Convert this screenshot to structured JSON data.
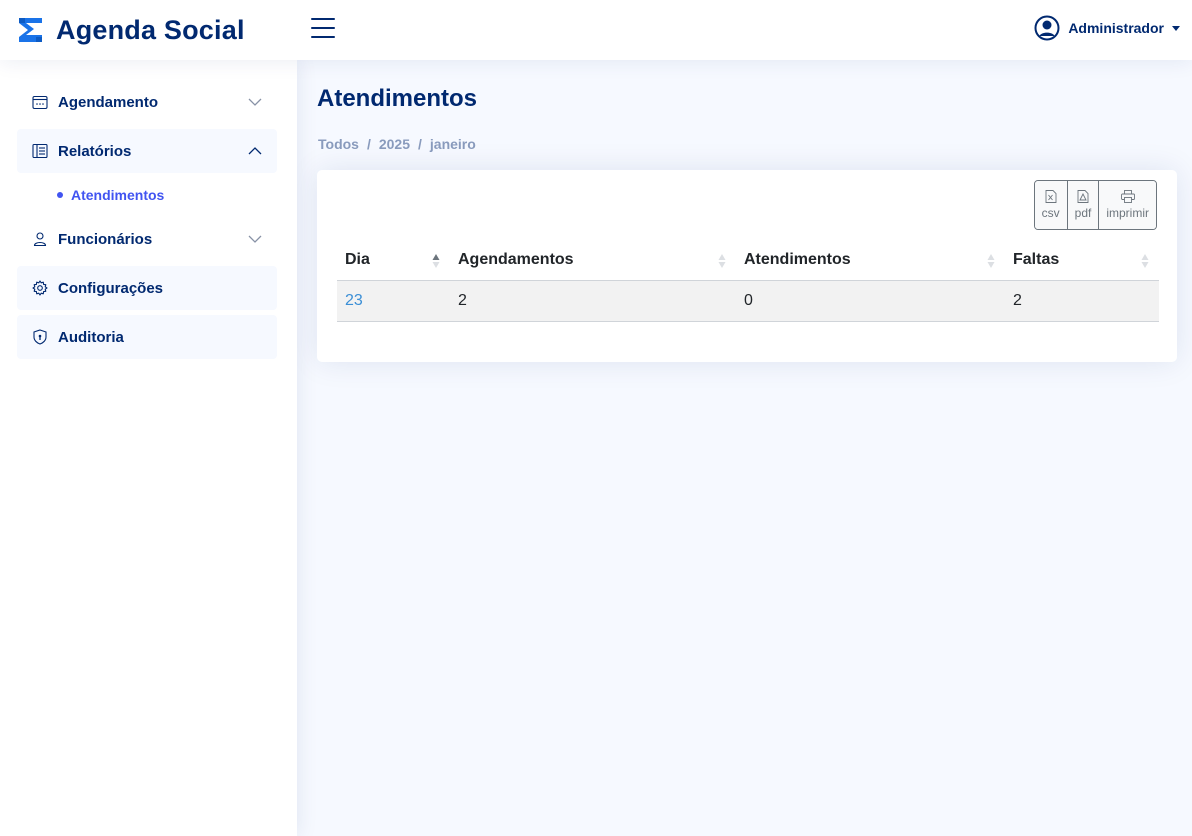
{
  "header": {
    "app_title": "Agenda Social",
    "user_name": "Administrador"
  },
  "sidebar": {
    "items": [
      {
        "label": "Agendamento",
        "icon": "calendar-icon",
        "expanded": false
      },
      {
        "label": "Relatórios",
        "icon": "report-icon",
        "expanded": true,
        "children": [
          {
            "label": "Atendimentos",
            "active": true
          }
        ]
      },
      {
        "label": "Funcionários",
        "icon": "person-icon",
        "expanded": false
      },
      {
        "label": "Configurações",
        "icon": "gear-icon"
      },
      {
        "label": "Auditoria",
        "icon": "shield-icon"
      }
    ]
  },
  "main": {
    "title": "Atendimentos",
    "breadcrumb": [
      "Todos",
      "2025",
      "janeiro"
    ]
  },
  "toolbar": {
    "buttons": [
      {
        "label": "csv",
        "icon": "file-excel-icon"
      },
      {
        "label": "pdf",
        "icon": "file-pdf-icon"
      },
      {
        "label": "imprimir",
        "icon": "printer-icon"
      }
    ]
  },
  "table": {
    "columns": [
      "Dia",
      "Agendamentos",
      "Atendimentos",
      "Faltas"
    ],
    "sorted_column": "Dia",
    "sort_direction": "asc",
    "rows": [
      [
        "23",
        "2",
        "0",
        "2"
      ]
    ]
  },
  "colors": {
    "primary": "#012970",
    "accent": "#4154f1",
    "link": "#3b8fd6",
    "background": "#f6f9ff",
    "muted": "#899bbd"
  }
}
